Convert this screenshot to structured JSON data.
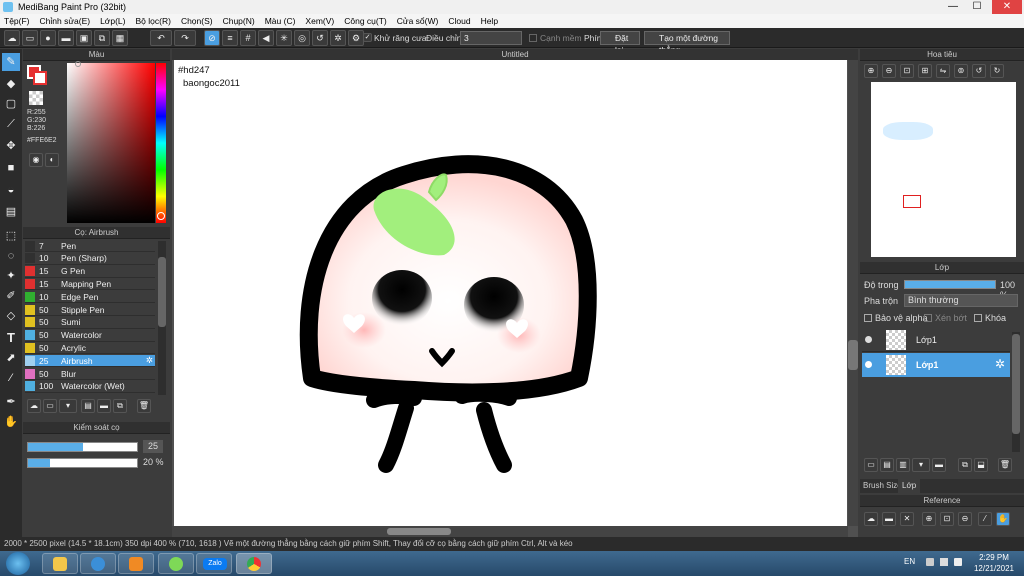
{
  "window": {
    "title": "MediBang Paint Pro (32bit)",
    "min": "—",
    "max": "☐",
    "close": "✕"
  },
  "menu": [
    "Tệp(F)",
    "Chỉnh sửa(E)",
    "Lớp(L)",
    "Bộ lọc(R)",
    "Chọn(S)",
    "Chụp(N)",
    "Màu (C)",
    "Xem(V)",
    "Công cụ(T)",
    "Cửa sổ(W)",
    "Cloud",
    "Help"
  ],
  "toolbar": {
    "antialias_label": "Khử răng cưa",
    "adjust_label": "Điều chỉnh",
    "adjust_value": "3",
    "edge_label": "Cạnh mềm",
    "key_label": "Phím",
    "reset_label": "Đặt lại",
    "straight_line_label": "Tạo một đường thẳng"
  },
  "color_panel": {
    "title": "Màu",
    "r": "R:255",
    "g": "G:230",
    "b": "B:226",
    "hex": "#FFE6E2",
    "primary": "#e63030",
    "secondary": "#ffffff"
  },
  "brush_panel": {
    "title": "Cọ: Airbrush",
    "items": [
      {
        "size": "7",
        "name": "Pen",
        "color": "#303030"
      },
      {
        "size": "10",
        "name": "Pen (Sharp)",
        "color": "#303030"
      },
      {
        "size": "15",
        "name": "G Pen",
        "color": "#e03030"
      },
      {
        "size": "15",
        "name": "Mapping Pen",
        "color": "#e03030"
      },
      {
        "size": "10",
        "name": "Edge Pen",
        "color": "#30b030"
      },
      {
        "size": "50",
        "name": "Stipple Pen",
        "color": "#e0c020"
      },
      {
        "size": "50",
        "name": "Sumi",
        "color": "#e0c020"
      },
      {
        "size": "50",
        "name": "Watercolor",
        "color": "#50b0e0"
      },
      {
        "size": "50",
        "name": "Acrylic",
        "color": "#e0c020"
      },
      {
        "size": "25",
        "name": "Airbrush",
        "color": "#a0d0f0",
        "selected": true
      },
      {
        "size": "50",
        "name": "Blur",
        "color": "#e070c0"
      },
      {
        "size": "100",
        "name": "Watercolor (Wet)",
        "color": "#50b0e0"
      }
    ]
  },
  "control_panel": {
    "title": "Kiểm soát cọ",
    "size_value": "25",
    "size_fill": 0.5,
    "opacity_value": "20 %",
    "opacity_fill": 0.2
  },
  "canvas": {
    "tab_title": "Untitled",
    "text1": "#hd247",
    "text2": "baongoc2011"
  },
  "navigator": {
    "title": "Hoa tiêu"
  },
  "layer_panel": {
    "title": "Lớp",
    "opacity_label": "Độ trong",
    "opacity_value": "100 %",
    "opacity_fill": 1.0,
    "blend_label": "Pha trộn",
    "blend_value": "Bình thường",
    "protect_alpha": "Bảo vệ alpha",
    "clipping": "Xén bớt",
    "lock": "Khóa",
    "layers": [
      {
        "name": "Lớp1",
        "selected": false
      },
      {
        "name": "Lớp1",
        "selected": true
      }
    ],
    "tab_brush_size": "Brush Size",
    "tab_layer": "Lớp"
  },
  "reference_panel": {
    "title": "Reference"
  },
  "status": {
    "dims": "2000 * 2500 pixel",
    "cm": "(14.5 * 18.1cm)",
    "dpi": "350 dpi",
    "zoom": "400 %",
    "coord": "(710, 1618 )",
    "hint": "Vẽ một đường thẳng bằng cách giữ phím Shift, Thay đổi cỡ cọ bằng cách giữ phím Ctrl, Alt và kéo"
  },
  "taskbar": {
    "lang": "EN",
    "time": "2:29 PM",
    "date": "12/21/2021",
    "zalo": "Zalo"
  }
}
